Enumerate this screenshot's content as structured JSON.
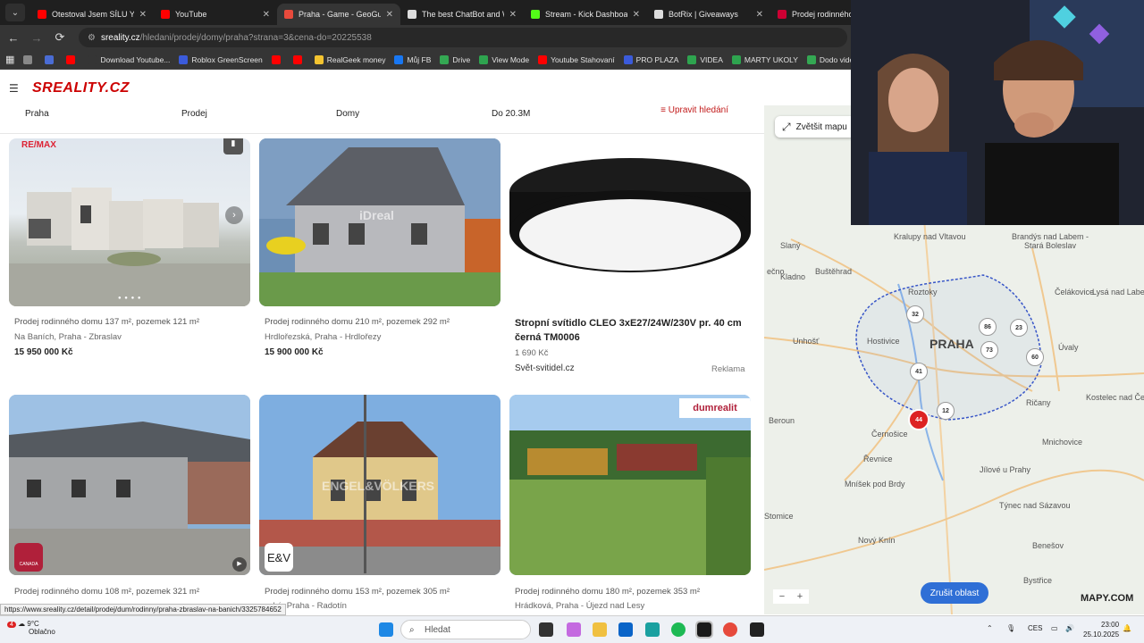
{
  "browser": {
    "tabs": [
      {
        "title": "Otestoval Jsem SÍLU YOU",
        "color": "#ff0000",
        "active": false
      },
      {
        "title": "YouTube",
        "color": "#ff0000",
        "active": false
      },
      {
        "title": "Praha - Game - GeoGues",
        "color": "#e84a3c",
        "active": true
      },
      {
        "title": "The best ChatBot and Wi",
        "color": "#dddddd",
        "active": false
      },
      {
        "title": "Stream - Kick Dashboard",
        "color": "#53fc18",
        "active": false
      },
      {
        "title": "BotRix | Giveaways",
        "color": "#dddddd",
        "active": false
      },
      {
        "title": "Prodej rodinného do",
        "color": "#cc0033",
        "active": false
      }
    ],
    "url_domain": "sreality.cz",
    "url_path": "/hledani/prodej/domy/praha?strana=3&cena-do=20225538",
    "bookmarks": [
      {
        "label": "",
        "color": "#888"
      },
      {
        "label": "",
        "color": "#4a6cd4"
      },
      {
        "label": "",
        "color": "#ff0000"
      },
      {
        "label": "Download Youtube...",
        "color": "#353535"
      },
      {
        "label": "Roblox GreenScreen",
        "color": "#3b5bdb"
      },
      {
        "label": "",
        "color": "#ff0000"
      },
      {
        "label": "",
        "color": "#ff0000"
      },
      {
        "label": "RealGeek money",
        "color": "#f4c430"
      },
      {
        "label": "Můj FB",
        "color": "#1877f2"
      },
      {
        "label": "Drive",
        "color": "#34a853"
      },
      {
        "label": "View Mode",
        "color": "#2ea44f"
      },
      {
        "label": "Youtube Stahovaní",
        "color": "#ff0000"
      },
      {
        "label": "PRO PLAZA",
        "color": "#3b5bdb"
      },
      {
        "label": "VIDEA",
        "color": "#2ea44f"
      },
      {
        "label": "MARTY UKOLY",
        "color": "#2ea44f"
      },
      {
        "label": "Dodo videa",
        "color": "#34a853"
      }
    ]
  },
  "site": {
    "logo": "SREALITY.CZ",
    "filters": {
      "location": "Praha",
      "type": "Prodej",
      "category": "Domy",
      "price": "Do 20.3M",
      "edit": "Upravit hledání"
    }
  },
  "listings": [
    {
      "title": "Prodej rodinného domu 137 m², pozemek 121 m²",
      "address": "Na Baních, Praha - Zbraslav",
      "price": "15 950 000 Kč",
      "badge": "RE/MAX"
    },
    {
      "title": "Prodej rodinného domu 210 m², pozemek 292 m²",
      "address": "Hrdlořezská, Praha - Hrdlořezy",
      "price": "15 900 000 Kč",
      "badge": "iDreal"
    },
    {
      "title": "Stropní svítidlo CLEO 3xE27/24W/230V pr. 40 cm černá TM0006",
      "price": "1 690 Kč",
      "seller": "Svět-svitidel.cz",
      "ad": "Reklama"
    },
    {
      "title": "Prodej rodinného domu 108 m², pozemek 321 m²",
      "address": "",
      "price": "",
      "badge": "CANADA"
    },
    {
      "title": "Prodej rodinného domu 153 m², pozemek 305 m²",
      "address": "vská, Praha - Radotín",
      "price": "",
      "badge": "E&V",
      "watermark": "ENGEL&VÖLKERS"
    },
    {
      "title": "Prodej rodinného domu 180 m², pozemek 353 m²",
      "address": "Hrádková, Praha - Újezd nad Lesy",
      "price": "",
      "badge": "dumrealit"
    }
  ],
  "map": {
    "enlarge": "Zvětšit mapu",
    "cancel_area": "Zrušit oblast",
    "brand": "MAPY.COM",
    "city": "PRAHA",
    "places": [
      "Kralupy nad Vltavou",
      "Brandýs nad Labem - Stará Boleslav",
      "Slaný",
      "Kladno",
      "Buštěhrad",
      "Roztoky",
      "Unhošť",
      "Hostivice",
      "Čelákovice",
      "Lysá nad Labem",
      "Úvaly",
      "Beroun",
      "Černošice",
      "Řevnice",
      "Mníšek pod Brdy",
      "Jílové u Prahy",
      "Týnec nad Sázavou",
      "Kostelec nad Černými lesy",
      "Mnichovice",
      "Ričany",
      "Nový Knín",
      "Benešov",
      "Bystřice",
      "Stomice",
      "ečno"
    ],
    "clusters": [
      "32",
      "86",
      "23",
      "73",
      "60",
      "41",
      "12",
      "44"
    ]
  },
  "status_url": "https://www.sreality.cz/detail/prodej/dum/rodinny/praha-zbraslav-na-banich/3325784652",
  "taskbar": {
    "weather_temp": "9°C",
    "weather_desc": "Oblačno",
    "weather_badge": "4",
    "search": "Hledat",
    "lang": "CES",
    "time": "23:00",
    "date": "25.10.2025"
  }
}
